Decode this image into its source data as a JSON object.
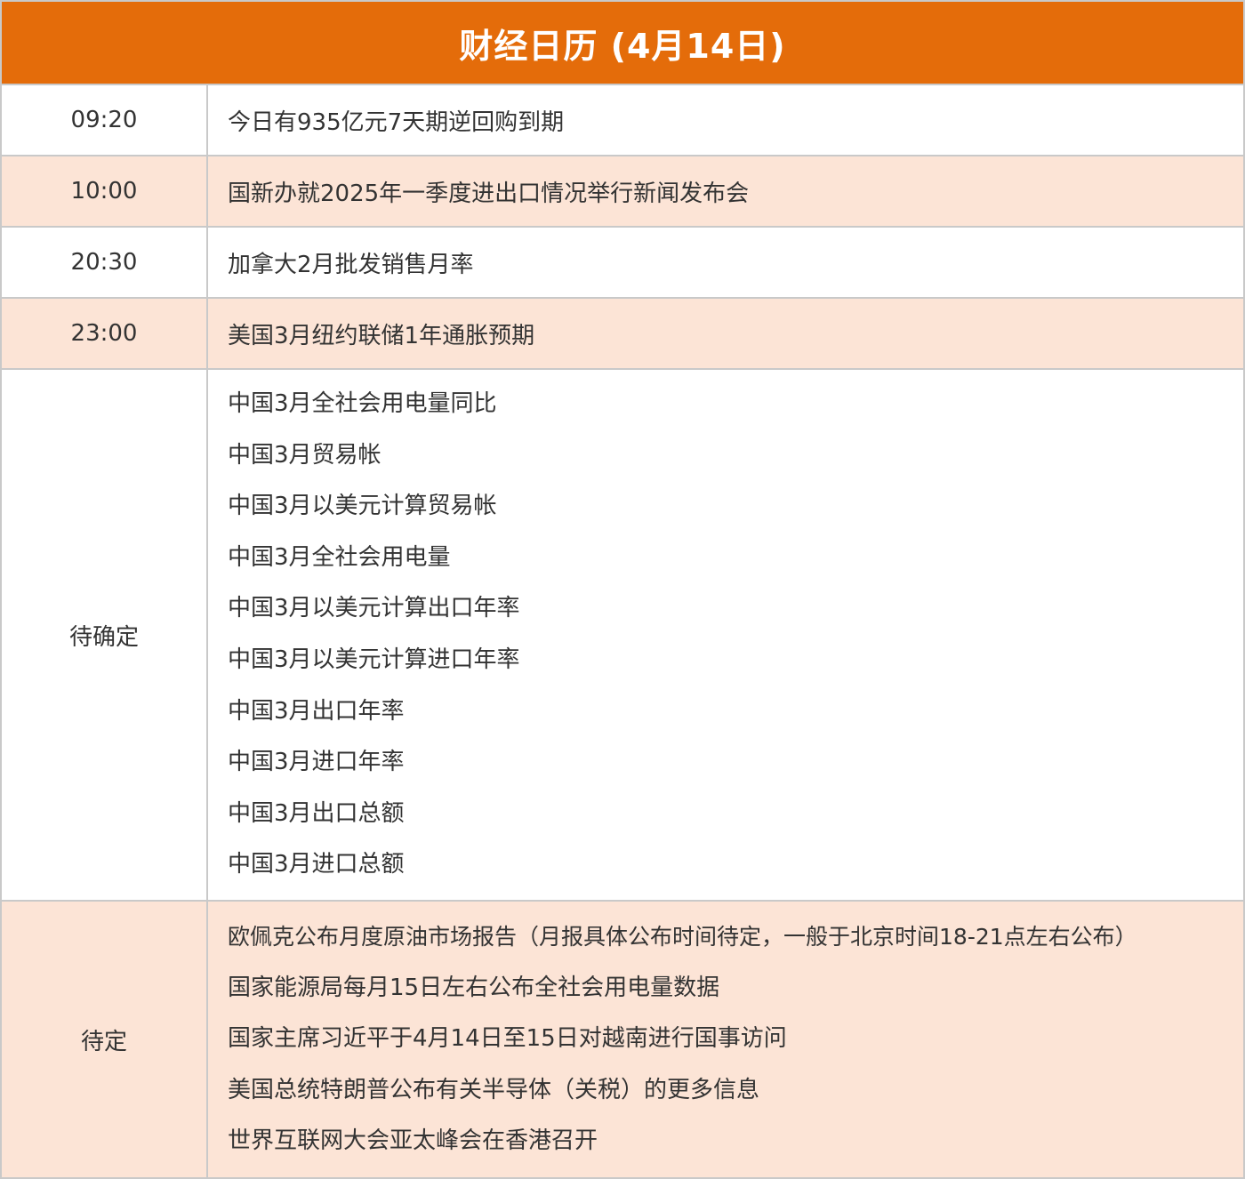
{
  "title": "财经日历 (4月14日)",
  "rows": [
    {
      "time": "09:20",
      "event": "今日有935亿元7天期逆回购到期"
    },
    {
      "time": "10:00",
      "event": "国新办就2025年一季度进出口情况举行新闻发布会"
    },
    {
      "time": "20:30",
      "event": "加拿大2月批发销售月率"
    },
    {
      "time": "23:00",
      "event": "美国3月纽约联储1年通胀预期"
    }
  ],
  "tbd": {
    "label": "待确定",
    "events": [
      "中国3月全社会用电量同比",
      "中国3月贸易帐",
      "中国3月以美元计算贸易帐",
      "中国3月全社会用电量",
      "中国3月以美元计算出口年率",
      "中国3月以美元计算进口年率",
      "中国3月出口年率",
      "中国3月进口年率",
      "中国3月出口总额",
      "中国3月进口总额"
    ]
  },
  "pending": {
    "label": "待定",
    "events": [
      "欧佩克公布月度原油市场报告（月报具体公布时间待定，一般于北京时间18-21点左右公布）",
      "国家能源局每月15日左右公布全社会用电量数据",
      "国家主席习近平于4月14日至15日对越南进行国事访问",
      "美国总统特朗普公布有关半导体（关税）的更多信息",
      "世界互联网大会亚太峰会在香港召开"
    ]
  },
  "colors": {
    "header_bg": "#E46C0A",
    "header_text": "#FFFFFF",
    "row_alt_bg": "#FCE4D6",
    "border": "#C9C9C9"
  }
}
